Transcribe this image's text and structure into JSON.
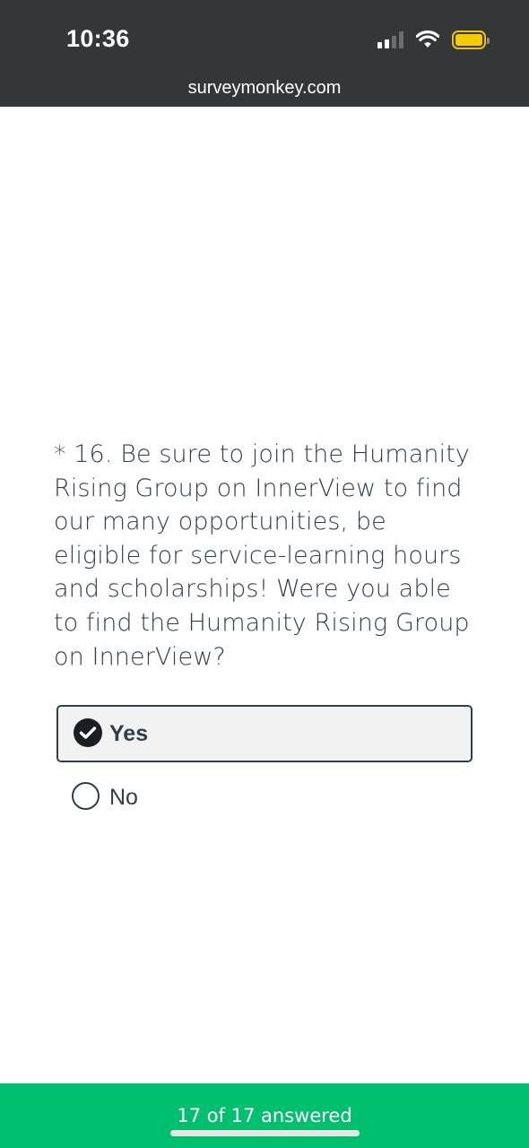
{
  "status_bar": {
    "time": "10:36",
    "icons": [
      "cellular-signal-icon",
      "wifi-icon",
      "battery-icon"
    ],
    "battery_color": "#f5cc00"
  },
  "browser": {
    "url": "surveymonkey.com"
  },
  "survey": {
    "question_text": "* 16. Be sure to join the Humanity Rising Group on InnerView to find our many opportunities, be eligible for service-learning hours and scholarships! Were you able to find the Humanity Rising Group on InnerView?",
    "options": [
      {
        "label": "Yes",
        "selected": true
      },
      {
        "label": "No",
        "selected": false
      }
    ]
  },
  "footer": {
    "progress_text": "17 of 17 answered",
    "color": "#00bf6f"
  }
}
